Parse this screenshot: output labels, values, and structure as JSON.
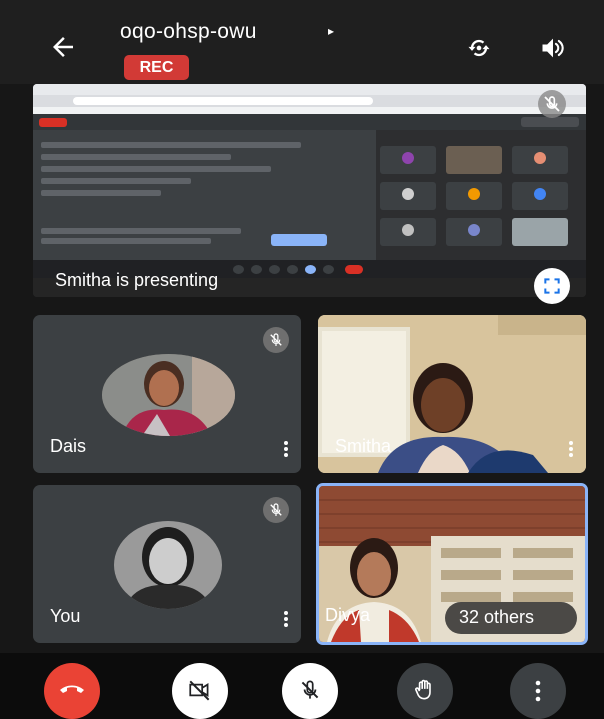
{
  "meeting": {
    "code": "oqo-ohsp-owu",
    "caret": "▸",
    "rec_badge": "REC"
  },
  "top_icons": [
    "back-arrow-icon",
    "switch-camera-icon",
    "speaker-icon"
  ],
  "presentation": {
    "caption": "Smitha is presenting",
    "fullscreen_icon": "fullscreen-icon"
  },
  "participants": [
    {
      "name": "Dais",
      "muted": true
    },
    {
      "name": "Smitha",
      "muted": false
    },
    {
      "name": "You",
      "muted": true
    },
    {
      "name": "Divya",
      "muted": false,
      "active_speaker": true
    }
  ],
  "others": {
    "label": "32 others"
  },
  "controls": [
    {
      "icon": "end-call-icon",
      "color": "#ea4335"
    },
    {
      "icon": "camera-off-icon",
      "color": "#ffffff"
    },
    {
      "icon": "mic-off-icon",
      "color": "#ffffff"
    },
    {
      "icon": "raise-hand-icon",
      "color": "#3c4043"
    },
    {
      "icon": "more-vert-icon",
      "color": "#3c4043"
    }
  ],
  "colors": {
    "rec": "#d23a36",
    "end_call": "#ea4335",
    "active_border": "#8ab4f8"
  }
}
